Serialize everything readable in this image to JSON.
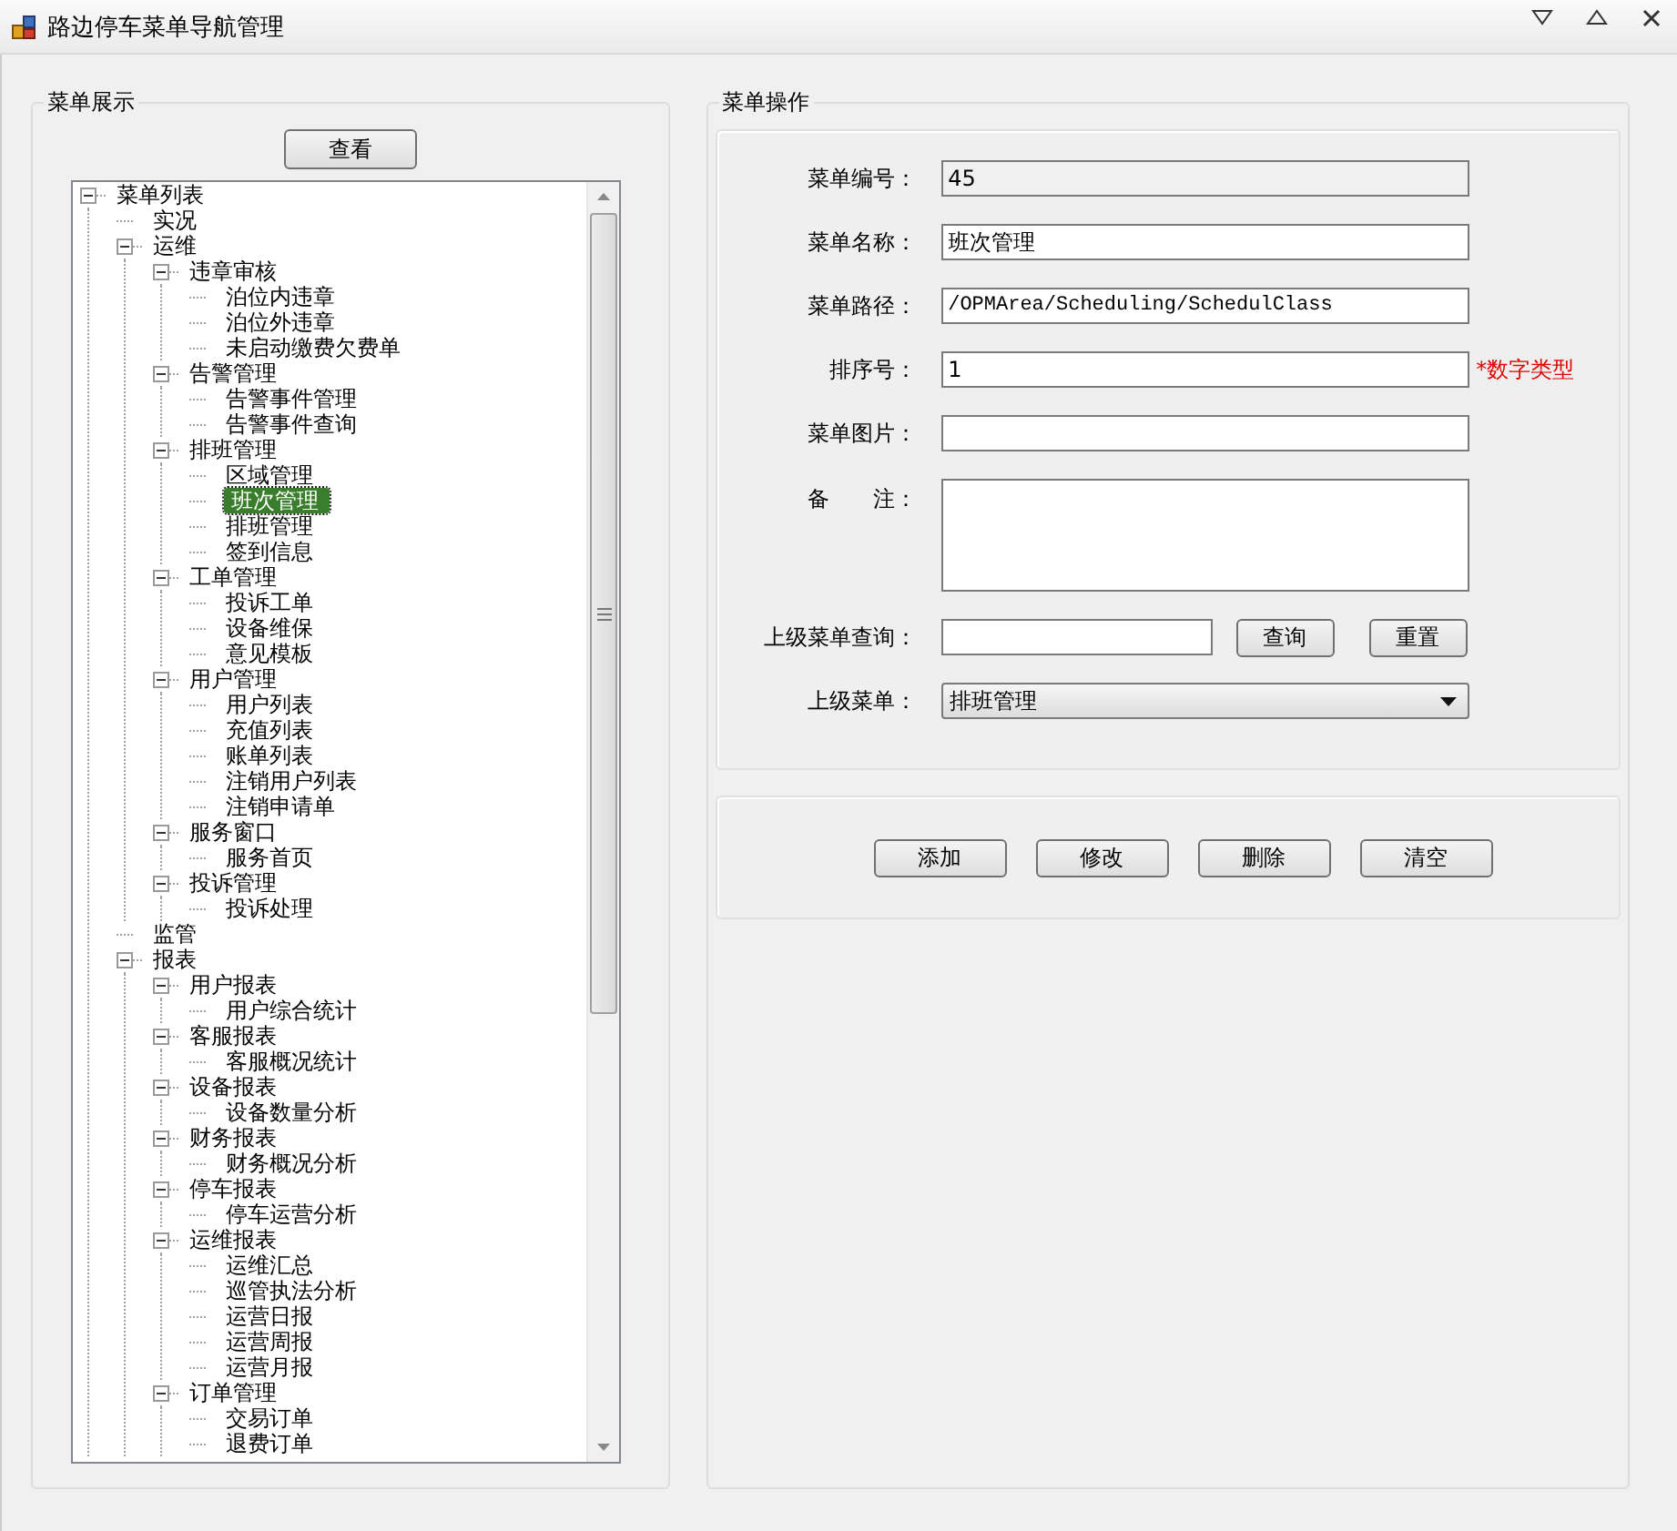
{
  "window": {
    "title": "路边停车菜单导航管理"
  },
  "left_group": {
    "title": "菜单展示",
    "view_button": "查看",
    "tree": [
      {
        "label": "菜单列表",
        "expanded": true,
        "selected": false,
        "children": [
          {
            "label": "实况",
            "selected": false
          },
          {
            "label": "运维",
            "expanded": true,
            "selected": false,
            "children": [
              {
                "label": "违章审核",
                "expanded": true,
                "selected": false,
                "children": [
                  {
                    "label": "泊位内违章",
                    "selected": false
                  },
                  {
                    "label": "泊位外违章",
                    "selected": false
                  },
                  {
                    "label": "未启动缴费欠费单",
                    "selected": false
                  }
                ]
              },
              {
                "label": "告警管理",
                "expanded": true,
                "selected": false,
                "children": [
                  {
                    "label": "告警事件管理",
                    "selected": false
                  },
                  {
                    "label": "告警事件查询",
                    "selected": false
                  }
                ]
              },
              {
                "label": "排班管理",
                "expanded": true,
                "selected": false,
                "children": [
                  {
                    "label": "区域管理",
                    "selected": false
                  },
                  {
                    "label": "班次管理",
                    "selected": true
                  },
                  {
                    "label": "排班管理",
                    "selected": false
                  },
                  {
                    "label": "签到信息",
                    "selected": false
                  }
                ]
              },
              {
                "label": "工单管理",
                "expanded": true,
                "selected": false,
                "children": [
                  {
                    "label": "投诉工单",
                    "selected": false
                  },
                  {
                    "label": "设备维保",
                    "selected": false
                  },
                  {
                    "label": "意见模板",
                    "selected": false
                  }
                ]
              },
              {
                "label": "用户管理",
                "expanded": true,
                "selected": false,
                "children": [
                  {
                    "label": "用户列表",
                    "selected": false
                  },
                  {
                    "label": "充值列表",
                    "selected": false
                  },
                  {
                    "label": "账单列表",
                    "selected": false
                  },
                  {
                    "label": "注销用户列表",
                    "selected": false
                  },
                  {
                    "label": "注销申请单",
                    "selected": false
                  }
                ]
              },
              {
                "label": "服务窗口",
                "expanded": true,
                "selected": false,
                "children": [
                  {
                    "label": "服务首页",
                    "selected": false
                  }
                ]
              },
              {
                "label": "投诉管理",
                "expanded": true,
                "selected": false,
                "children": [
                  {
                    "label": "投诉处理",
                    "selected": false
                  }
                ]
              }
            ]
          },
          {
            "label": "监管",
            "selected": false
          },
          {
            "label": "报表",
            "expanded": true,
            "selected": false,
            "children": [
              {
                "label": "用户报表",
                "expanded": true,
                "selected": false,
                "children": [
                  {
                    "label": "用户综合统计",
                    "selected": false
                  }
                ]
              },
              {
                "label": "客服报表",
                "expanded": true,
                "selected": false,
                "children": [
                  {
                    "label": "客服概况统计",
                    "selected": false
                  }
                ]
              },
              {
                "label": "设备报表",
                "expanded": true,
                "selected": false,
                "children": [
                  {
                    "label": "设备数量分析",
                    "selected": false
                  }
                ]
              },
              {
                "label": "财务报表",
                "expanded": true,
                "selected": false,
                "children": [
                  {
                    "label": "财务概况分析",
                    "selected": false
                  }
                ]
              },
              {
                "label": "停车报表",
                "expanded": true,
                "selected": false,
                "children": [
                  {
                    "label": "停车运营分析",
                    "selected": false
                  }
                ]
              },
              {
                "label": "运维报表",
                "expanded": true,
                "selected": false,
                "children": [
                  {
                    "label": "运维汇总",
                    "selected": false
                  },
                  {
                    "label": "巡管执法分析",
                    "selected": false
                  },
                  {
                    "label": "运营日报",
                    "selected": false
                  },
                  {
                    "label": "运营周报",
                    "selected": false
                  },
                  {
                    "label": "运营月报",
                    "selected": false
                  }
                ]
              },
              {
                "label": "订单管理",
                "expanded": true,
                "selected": false,
                "children": [
                  {
                    "label": "交易订单",
                    "selected": false
                  },
                  {
                    "label": "退费订单",
                    "selected": false
                  }
                ]
              }
            ]
          }
        ]
      }
    ]
  },
  "right_group": {
    "title": "菜单操作",
    "fields": [
      {
        "kind": "text",
        "label": "菜单编号：",
        "value": "45",
        "disabled": true
      },
      {
        "kind": "text",
        "label": "菜单名称：",
        "value": "班次管理",
        "disabled": false
      },
      {
        "kind": "path",
        "label": "菜单路径：",
        "value": "/OPMArea/Scheduling/SchedulClass",
        "disabled": false
      },
      {
        "kind": "text",
        "label": "排序号：",
        "value": "1",
        "disabled": false,
        "note": "*数字类型"
      },
      {
        "kind": "text",
        "label": "菜单图片：",
        "disabled": false
      },
      {
        "kind": "textarea",
        "label": "备　　注：",
        "disabled": false
      },
      {
        "kind": "search",
        "label": "上级菜单查询：",
        "disabled": false,
        "buttons": [
          "查询",
          "重置"
        ]
      },
      {
        "kind": "select",
        "label": "上级菜单：",
        "value": "排班管理",
        "disabled": false
      }
    ],
    "actions": [
      "添加",
      "修改",
      "删除",
      "清空"
    ]
  }
}
